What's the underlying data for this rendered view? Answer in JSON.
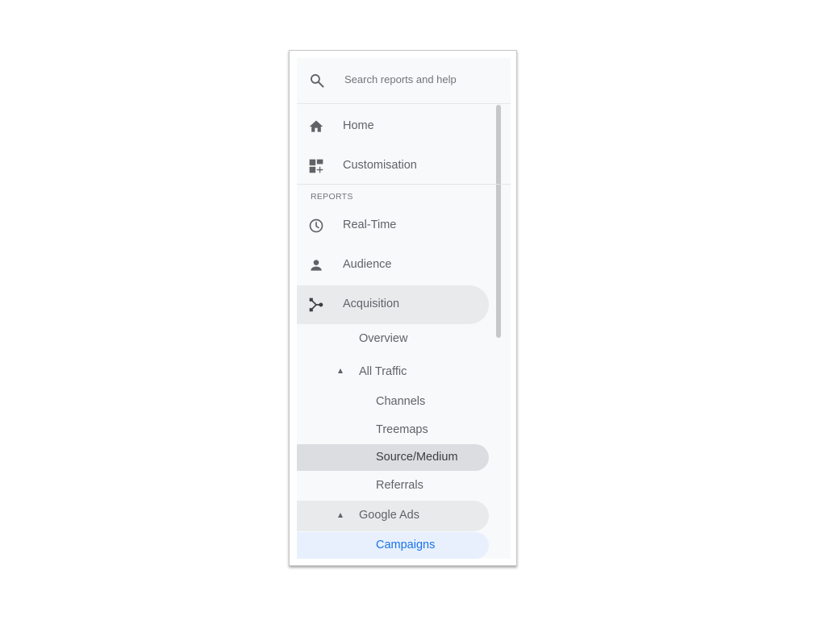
{
  "search": {
    "placeholder": "Search reports and help",
    "icon": "search-icon"
  },
  "nav": {
    "top_items": [
      {
        "label": "Home",
        "icon": "home-icon"
      },
      {
        "label": "Customisation",
        "icon": "dashboard-add-icon"
      }
    ],
    "section_label": "REPORTS",
    "report_items": [
      {
        "label": "Real-Time",
        "icon": "clock-icon"
      },
      {
        "label": "Audience",
        "icon": "person-icon"
      },
      {
        "label": "Acquisition",
        "icon": "acquisition-icon",
        "expanded": true
      }
    ],
    "acquisition": {
      "overview": "Overview",
      "all_traffic": {
        "label": "All Traffic",
        "expanded": true,
        "children": [
          "Channels",
          "Treemaps",
          "Source/Medium",
          "Referrals"
        ],
        "selected": "Source/Medium"
      },
      "google_ads": {
        "label": "Google Ads",
        "expanded": true,
        "children": [
          "Campaigns"
        ],
        "current": "Campaigns"
      }
    }
  },
  "colors": {
    "accent": "#1a73e8",
    "current_bg": "#e8f0fe",
    "selected_bg": "#dcdde0",
    "panel_bg": "#f8f9fa"
  }
}
